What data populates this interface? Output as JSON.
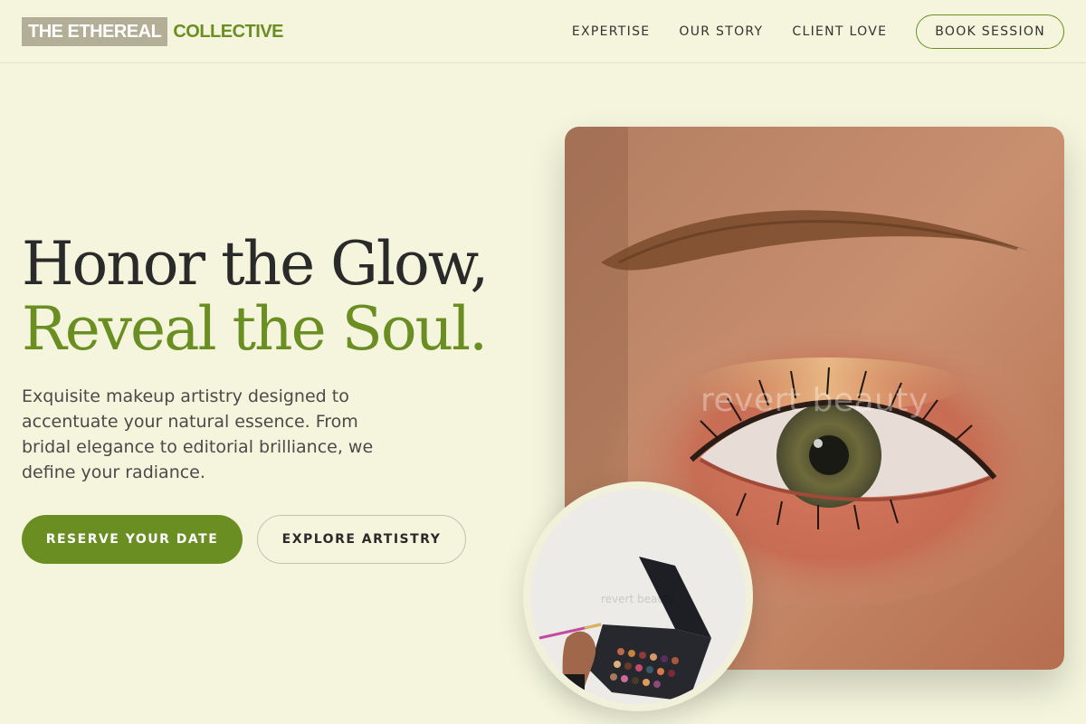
{
  "header": {
    "logo_part1": "THE ETHEREAL",
    "logo_part2": "COLLECTIVE",
    "nav": [
      "EXPERTISE",
      "OUR STORY",
      "CLIENT LOVE"
    ],
    "cta": "BOOK SESSION"
  },
  "hero": {
    "headline_line1": "Honor the Glow,",
    "headline_line2": "Reveal the Soul.",
    "description": "Exquisite makeup artistry designed to accentuate your natural essence. From bridal elegance to editorial brilliance, we define your radiance.",
    "primary_button": "RESERVE YOUR DATE",
    "secondary_button": "EXPLORE ARTISTRY",
    "image_watermark": "revert beauty",
    "inset_watermark": "revert beauty"
  },
  "colors": {
    "background": "#f4f5dc",
    "accent": "#6b8e23",
    "logo_block": "#b3ae96"
  },
  "icons": [
    "eye-makeup-photo",
    "eyeshadow-palette-photo"
  ]
}
